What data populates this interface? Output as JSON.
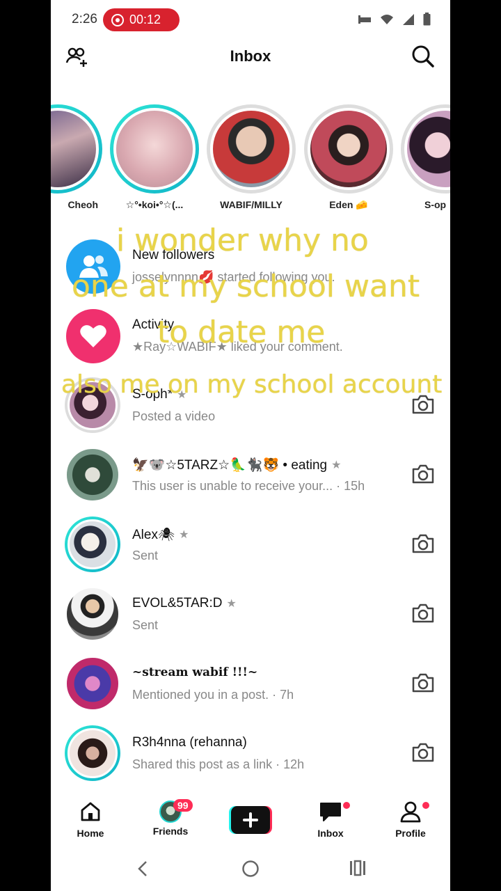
{
  "status_bar": {
    "time": "2:26",
    "recording": "00:12"
  },
  "header": {
    "title": "Inbox"
  },
  "stories": [
    {
      "name": "Cheoh"
    },
    {
      "name": "☆°•koi•°☆(..."
    },
    {
      "name": "WABIF/MILLY"
    },
    {
      "name": "Eden 🧀"
    },
    {
      "name": "S-op"
    }
  ],
  "rows": {
    "new_followers": {
      "title": "New followers",
      "subtitle": "josselynnnn💋 started following you."
    },
    "activity": {
      "title": "Activity",
      "subtitle": "★Ray☆WABIF★ liked your comment."
    },
    "chats": [
      {
        "name": "S-oph*",
        "subtitle": "Posted a video"
      },
      {
        "name": "🦅🐨☆5TARZ☆🦜🐈‍⬛🐯 • eating",
        "subtitle": "This user is unable to receive your... · 15h"
      },
      {
        "name": "Alex🕷",
        "subtitle": "Sent"
      },
      {
        "name": "EVOL&5TAR:D",
        "subtitle": "Sent"
      },
      {
        "name": "~stream wabif !!!~",
        "subtitle": "Mentioned you in a post. · 7h"
      },
      {
        "name": "R3h4nna (rehanna)",
        "subtitle": "Shared this post as a link · 12h"
      }
    ]
  },
  "caption": {
    "line1": "i wonder why no",
    "line2": "one at my school want",
    "line3": "to date me",
    "line4": "also me on my school account"
  },
  "nav": {
    "home": "Home",
    "friends": "Friends",
    "friends_badge": "99",
    "inbox": "Inbox",
    "profile": "Profile"
  },
  "colors": {
    "accent_ring": "#20d5d0",
    "badge": "#fe2c55",
    "caption": "#e8d44a"
  }
}
